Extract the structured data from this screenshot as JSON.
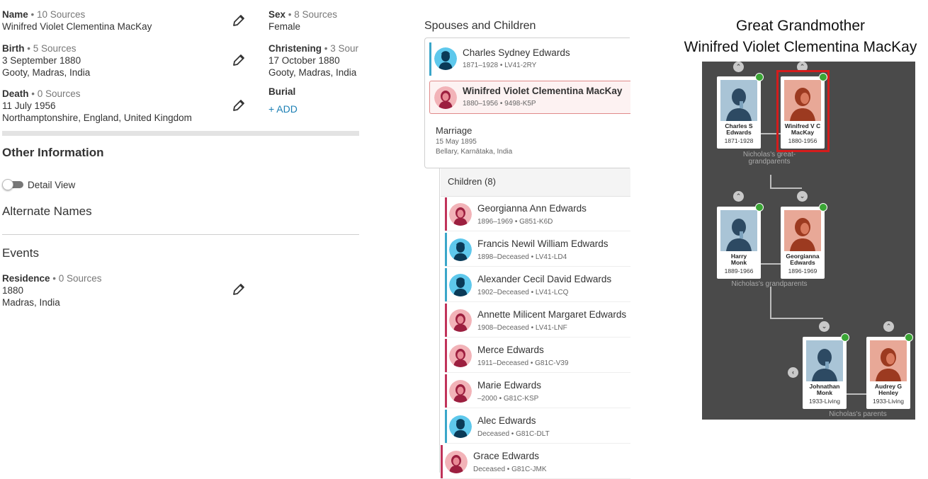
{
  "vitals": {
    "name": {
      "label": "Name",
      "sources": " • 10 Sources",
      "value": "Winifred Violet Clementina MacKay"
    },
    "sex": {
      "label": "Sex",
      "sources": " • 8 Sources",
      "value": "Female"
    },
    "birth": {
      "label": "Birth",
      "sources": " • 5 Sources",
      "date": "3 September 1880",
      "place": "Gooty, Madras, India"
    },
    "christening": {
      "label": "Christening",
      "sources": " • 3 Sour",
      "date": "17 October 1880",
      "place": "Gooty, Madras, India"
    },
    "death": {
      "label": "Death",
      "sources": " • 0 Sources",
      "date": "11 July 1956",
      "place": "Northamptonshire, England, United Kingdom"
    },
    "burial": {
      "label": "Burial",
      "add_label": "+  ADD"
    }
  },
  "other_information": {
    "title": "Other Information",
    "detail_view_label": "Detail View",
    "alternate_names_title": "Alternate Names",
    "events_title": "Events",
    "residence": {
      "label": "Residence",
      "sources": " • 0 Sources",
      "date": "1880",
      "place": "Madras, India"
    }
  },
  "family": {
    "title": "Spouses and Children",
    "husband": {
      "name": "Charles Sydney Edwards",
      "meta": "1871–1928 • LV41-2RY"
    },
    "wife": {
      "name": "Winifred Violet Clementina MacKay",
      "meta": "1880–1956 • 9498-K5P"
    },
    "marriage": {
      "label": "Marriage",
      "date": "15 May 1895",
      "place": "Bellary, Karnātaka, India"
    },
    "children_title": "Children (8)",
    "children": [
      {
        "name": "Georgianna Ann Edwards",
        "meta": "1896–1969 • G851-K6D",
        "gender": "female"
      },
      {
        "name": "Francis Newil William Edwards",
        "meta": "1898–Deceased • LV41-LD4",
        "gender": "male"
      },
      {
        "name": "Alexander Cecil David Edwards",
        "meta": "1902–Deceased • LV41-LCQ",
        "gender": "male"
      },
      {
        "name": "Annette Milicent Margaret Edwards",
        "meta": "1908–Deceased • LV41-LNF",
        "gender": "female"
      },
      {
        "name": "Merce Edwards",
        "meta": "1911–Deceased • G81C-V39",
        "gender": "female"
      },
      {
        "name": "Marie Edwards",
        "meta": "–2000 • G81C-KSP",
        "gender": "female"
      },
      {
        "name": "Alec Edwards",
        "meta": "Deceased • G81C-DLT",
        "gender": "male"
      },
      {
        "name": "Grace Edwards",
        "meta": "Deceased • G81C-JMK",
        "gender": "female"
      }
    ]
  },
  "pedigree": {
    "title_line1": "Great Grandmother",
    "title_line2": "Winifred Violet Clementina MacKay",
    "gen1_label": "Nicholas's great-\ngrandparents",
    "gen2_label": "Nicholas's grandparents",
    "gen3_label": "Nicholas's parents",
    "cards": {
      "charles": {
        "name": "Charles S\nEdwards",
        "dates": "1871-1928"
      },
      "winifred": {
        "name": "Winifred V C\nMacKay",
        "dates": "1880-1956"
      },
      "harry": {
        "name": "Harry\nMonk",
        "dates": "1889-1966"
      },
      "georgianna": {
        "name": "Georgianna\nEdwards",
        "dates": "1896-1969"
      },
      "johnathan": {
        "name": "Johnathan\nMonk",
        "dates": "1933-Living"
      },
      "audrey": {
        "name": "Audrey G\nHenley",
        "dates": "1933-Living"
      }
    }
  },
  "colors": {
    "male_bar": "#3aa6c9",
    "female_bar": "#c0335a",
    "male_bg": "#5ec8ec",
    "female_bg": "#f2b3b8",
    "link": "#1b7fb4",
    "tree_bg": "#4a4a4a",
    "highlight": "#d41c1c",
    "badge": "#3aa535"
  },
  "icons": {
    "edit": "pencil-icon",
    "male": "male-avatar-icon",
    "female": "female-avatar-icon",
    "chevron": "chevron-icon",
    "badge": "record-hint-icon"
  }
}
